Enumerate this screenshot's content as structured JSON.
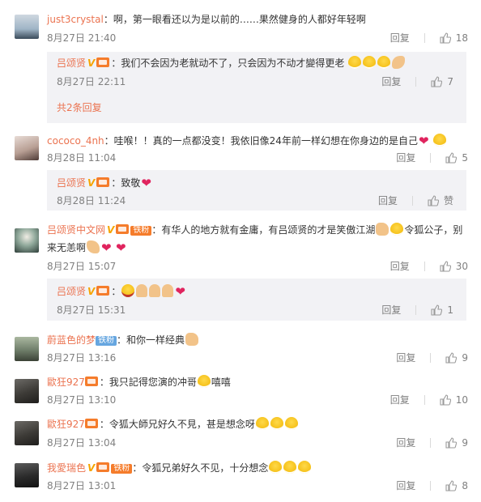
{
  "ui": {
    "reply_label": "回复",
    "like_label_default": "赞"
  },
  "comments": [
    {
      "username": "just3crystal",
      "text": "：啊，第一眼看还以为是以前的……果然健身的人都好年轻啊",
      "time": "8月27日 21:40",
      "likes": "18",
      "replies": [
        {
          "username": "吕颂贤",
          "text": "：我们不会因为老就动不了，只会因为不动才變得更老",
          "time": "8月27日 22:11",
          "likes": "7"
        }
      ],
      "expand_label": "共2条回复"
    },
    {
      "username": "cococo_4nh",
      "text": "：哇喉！！真的一点都没变！我依旧像24年前一样幻想在你身边的是自己",
      "time": "8月28日 11:04",
      "likes": "5",
      "replies": [
        {
          "username": "吕颂贤",
          "text": "：致敬",
          "time": "8月28日 11:24",
          "likes": "赞"
        }
      ]
    },
    {
      "username": "吕颂贤中文网",
      "text_line1": "：有华人的地方就有金庸，有吕颂贤的才是笑傲江湖",
      "text_line1b": "令狐公子，别",
      "text_line2": "来无恙啊",
      "fan_badge": "铁粉",
      "time": "8月27日 15:07",
      "likes": "30",
      "replies": [
        {
          "username": "吕颂贤",
          "text": "：",
          "time": "8月27日 15:31",
          "likes": "1"
        }
      ]
    },
    {
      "username": "蔚蓝色的梦",
      "fan_badge": "铁粉",
      "text": "：和你一样经典",
      "time": "8月27日 13:16",
      "likes": "9"
    },
    {
      "username": "歐狂927",
      "text": "：我只記得您演的冲哥",
      "text_tail": "嘻嘻",
      "time": "8月27日 13:10",
      "likes": "10"
    },
    {
      "username": "歐狂927",
      "text": "：令狐大師兄好久不見，甚是想念呀",
      "time": "8月27日 13:04",
      "likes": "9"
    },
    {
      "username": "我愛瑞色",
      "fan_badge": "铁粉",
      "text": "：令狐兄弟好久不见，十分想念",
      "time": "8月27日 13:01",
      "likes": "8"
    }
  ]
}
